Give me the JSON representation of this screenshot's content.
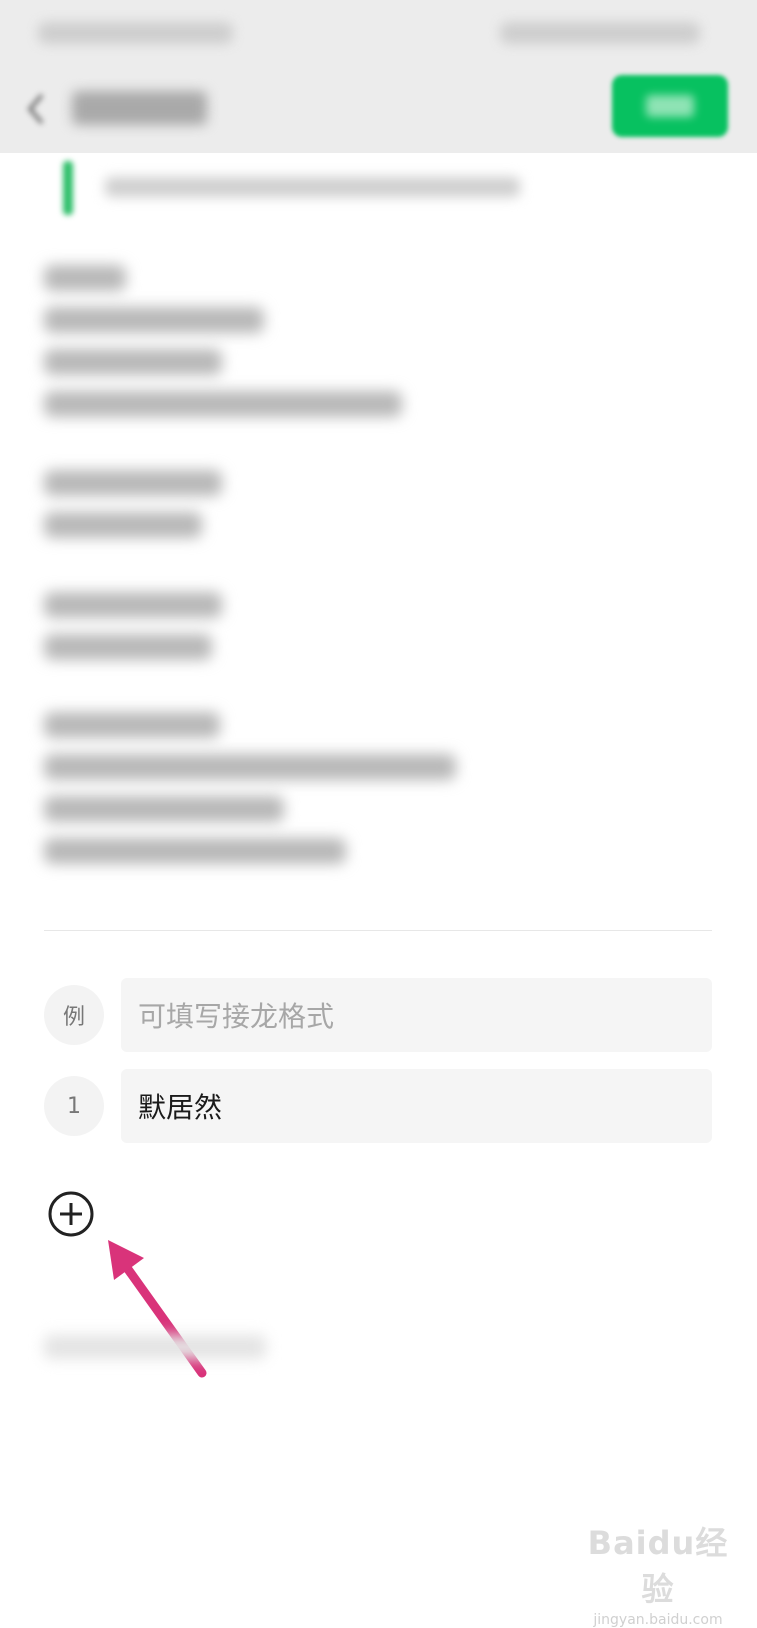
{
  "form": {
    "example_badge": "例",
    "example_placeholder": "可填写接龙格式",
    "entries": [
      {
        "index": "1",
        "value": "默居然"
      }
    ]
  },
  "icons": {
    "add": "add-circle-icon",
    "back": "chevron-left-icon",
    "notice": "info-icon"
  },
  "colors": {
    "done_button": "#07c160",
    "annotation_arrow": "#d9337a"
  },
  "watermark": {
    "brand": "Baidu经验",
    "url": "jingyan.baidu.com"
  }
}
